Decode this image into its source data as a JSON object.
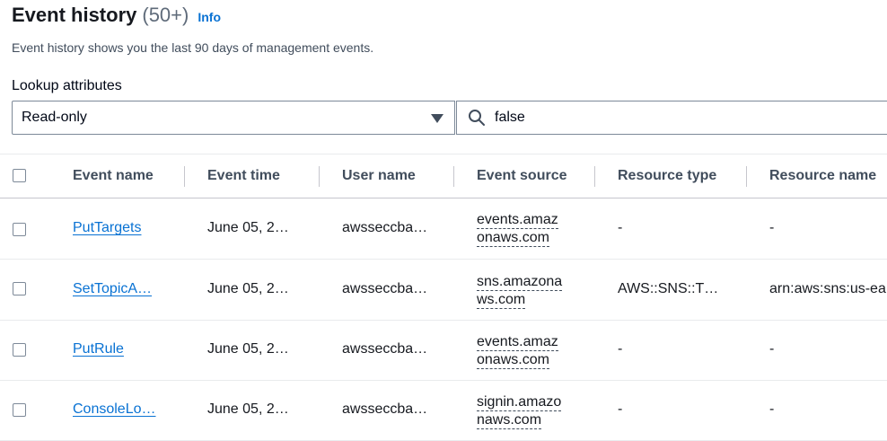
{
  "header": {
    "title": "Event history",
    "count": "(50+)",
    "info": "Info"
  },
  "description": "Event history shows you the last 90 days of management events.",
  "lookup": {
    "label": "Lookup attributes",
    "attribute": "Read-only",
    "search_value": "false"
  },
  "table": {
    "columns": [
      "Event name",
      "Event time",
      "User name",
      "Event source",
      "Resource type",
      "Resource name"
    ],
    "rows": [
      {
        "event_name": "PutTargets",
        "event_time": "June 05, 2…",
        "user_name": "awsseccba…",
        "source_l1": "events.amaz",
        "source_l2": "onaws.com",
        "resource_type": "-",
        "resource_name": "-"
      },
      {
        "event_name": "SetTopicA…",
        "event_time": "June 05, 2…",
        "user_name": "awsseccba…",
        "source_l1": "sns.amazona",
        "source_l2": "ws.com",
        "resource_type": "AWS::SNS::T…",
        "resource_name": "arn:aws:sns:us-ea"
      },
      {
        "event_name": "PutRule",
        "event_time": "June 05, 2…",
        "user_name": "awsseccba…",
        "source_l1": "events.amaz",
        "source_l2": "onaws.com",
        "resource_type": "-",
        "resource_name": "-"
      },
      {
        "event_name": "ConsoleLo…",
        "event_time": "June 05, 2…",
        "user_name": "awsseccba…",
        "source_l1": "signin.amazo",
        "source_l2": "naws.com",
        "resource_type": "-",
        "resource_name": "-"
      }
    ]
  },
  "colors": {
    "link": "#0972d3",
    "text": "#16191f",
    "muted": "#5f6b7a"
  },
  "icons": {
    "dropdown": "caret-down-icon",
    "search": "search-icon"
  }
}
